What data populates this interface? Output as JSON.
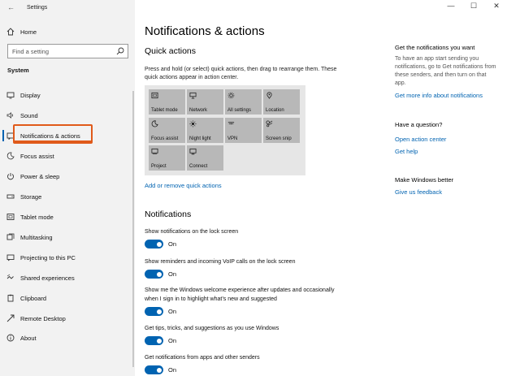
{
  "window": {
    "title": "Settings",
    "controls": {
      "minimize": "—",
      "maximize": "☐",
      "close": "✕"
    }
  },
  "sidebar": {
    "home_label": "Home",
    "search_placeholder": "Find a setting",
    "section_label": "System",
    "items": [
      {
        "label": "Display",
        "icon": "display-icon"
      },
      {
        "label": "Sound",
        "icon": "sound-icon"
      },
      {
        "label": "Notifications & actions",
        "icon": "notifications-icon",
        "selected": true
      },
      {
        "label": "Focus assist",
        "icon": "focus-assist-icon"
      },
      {
        "label": "Power & sleep",
        "icon": "power-icon"
      },
      {
        "label": "Storage",
        "icon": "storage-icon"
      },
      {
        "label": "Tablet mode",
        "icon": "tablet-mode-icon"
      },
      {
        "label": "Multitasking",
        "icon": "multitasking-icon"
      },
      {
        "label": "Projecting to this PC",
        "icon": "projecting-icon"
      },
      {
        "label": "Shared experiences",
        "icon": "shared-experiences-icon"
      },
      {
        "label": "Clipboard",
        "icon": "clipboard-icon"
      },
      {
        "label": "Remote Desktop",
        "icon": "remote-desktop-icon"
      },
      {
        "label": "About",
        "icon": "info-icon"
      }
    ]
  },
  "main": {
    "title": "Notifications & actions",
    "quick_actions": {
      "heading": "Quick actions",
      "description": "Press and hold (or select) quick actions, then drag to rearrange them. These quick actions appear in action center.",
      "tiles": [
        {
          "label": "Tablet mode",
          "icon": "tablet-mode-icon"
        },
        {
          "label": "Network",
          "icon": "network-icon"
        },
        {
          "label": "All settings",
          "icon": "gear-icon"
        },
        {
          "label": "Location",
          "icon": "location-icon"
        },
        {
          "label": "Focus assist",
          "icon": "moon-icon"
        },
        {
          "label": "Night light",
          "icon": "sun-icon"
        },
        {
          "label": "VPN",
          "icon": "vpn-icon"
        },
        {
          "label": "Screen snip",
          "icon": "scissors-icon"
        },
        {
          "label": "Project",
          "icon": "project-icon"
        },
        {
          "label": "Connect",
          "icon": "connect-icon"
        }
      ],
      "add_remove_link": "Add or remove quick actions"
    },
    "notifications": {
      "heading": "Notifications",
      "settings": [
        {
          "text": "Show notifications on the lock screen",
          "state": "On"
        },
        {
          "text": "Show reminders and incoming VoIP calls on the lock screen",
          "state": "On"
        },
        {
          "text": "Show me the Windows welcome experience after updates and occasionally when I sign in to highlight what’s new and suggested",
          "state": "On"
        },
        {
          "text": "Get tips, tricks, and suggestions as you use Windows",
          "state": "On"
        },
        {
          "text": "Get notifications from apps and other senders",
          "state": "On"
        }
      ]
    }
  },
  "right_column": {
    "get_notifications": {
      "title": "Get the notifications you want",
      "text": "To have an app start sending you notifications, go to Get notifications from these senders, and then turn on that app.",
      "link": "Get more info about notifications"
    },
    "question": {
      "title": "Have a question?",
      "links": [
        "Open action center",
        "Get help"
      ]
    },
    "better": {
      "title": "Make Windows better",
      "link": "Give us feedback"
    }
  },
  "colors": {
    "accent": "#0063b1",
    "sidebar_bg": "#f2f2f2",
    "tile_bg": "#b8b8b8",
    "panel_bg": "#e6e6e6",
    "highlight": "#e05a1a"
  }
}
